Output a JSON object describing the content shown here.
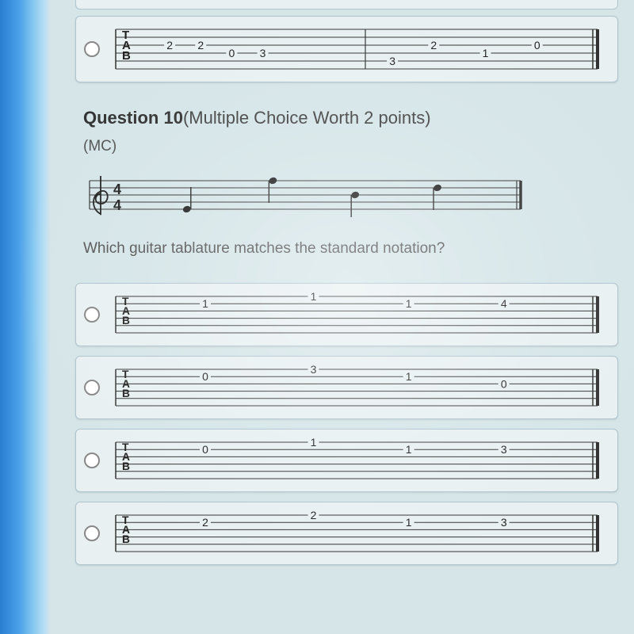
{
  "prev_option": {
    "tab_label": [
      "T",
      "A",
      "B"
    ],
    "notes_m1": [
      {
        "string": 2,
        "x": 0.1,
        "fret": "2"
      },
      {
        "string": 2,
        "x": 0.25,
        "fret": "2"
      },
      {
        "string": 3,
        "x": 0.4,
        "fret": "0"
      },
      {
        "string": 3,
        "x": 0.55,
        "fret": "3"
      }
    ],
    "notes_m2": [
      {
        "string": 4,
        "x": 0.1,
        "fret": "3"
      },
      {
        "string": 2,
        "x": 0.3,
        "fret": "2"
      },
      {
        "string": 3,
        "x": 0.55,
        "fret": "1"
      },
      {
        "string": 2,
        "x": 0.8,
        "fret": "0"
      }
    ]
  },
  "question": {
    "label_prefix": "Question ",
    "number": "10",
    "label_suffix": "(Multiple Choice Worth 2 points)",
    "mc": "(MC)",
    "prompt": "Which guitar tablature matches the standard notation?"
  },
  "staff": {
    "time_sig_top": "4",
    "time_sig_bot": "4",
    "notes": [
      {
        "x": 0.15,
        "line": 4,
        "stem": "up"
      },
      {
        "x": 0.38,
        "line": 0,
        "stem": "down"
      },
      {
        "x": 0.6,
        "line": 2,
        "stem": "down"
      },
      {
        "x": 0.82,
        "line": 1,
        "stem": "down"
      }
    ]
  },
  "options": [
    {
      "tab_label": [
        "T",
        "A",
        "B"
      ],
      "notes": [
        {
          "string": 1,
          "x": 0.13,
          "fret": "1"
        },
        {
          "string": 0,
          "x": 0.38,
          "fret": "1"
        },
        {
          "string": 1,
          "x": 0.6,
          "fret": "1"
        },
        {
          "string": 1,
          "x": 0.82,
          "fret": "4"
        }
      ]
    },
    {
      "tab_label": [
        "T",
        "A",
        "B"
      ],
      "notes": [
        {
          "string": 1,
          "x": 0.13,
          "fret": "0"
        },
        {
          "string": 0,
          "x": 0.38,
          "fret": "3"
        },
        {
          "string": 1,
          "x": 0.6,
          "fret": "1"
        },
        {
          "string": 2,
          "x": 0.82,
          "fret": "0"
        }
      ]
    },
    {
      "tab_label": [
        "T",
        "A",
        "B"
      ],
      "notes": [
        {
          "string": 1,
          "x": 0.13,
          "fret": "0"
        },
        {
          "string": 0,
          "x": 0.38,
          "fret": "1"
        },
        {
          "string": 1,
          "x": 0.6,
          "fret": "1"
        },
        {
          "string": 1,
          "x": 0.82,
          "fret": "3"
        }
      ]
    },
    {
      "tab_label": [
        "T",
        "A",
        "B"
      ],
      "notes": [
        {
          "string": 1,
          "x": 0.13,
          "fret": "2"
        },
        {
          "string": 0,
          "x": 0.38,
          "fret": "2"
        },
        {
          "string": 1,
          "x": 0.6,
          "fret": "1"
        },
        {
          "string": 1,
          "x": 0.82,
          "fret": "3"
        }
      ]
    }
  ]
}
